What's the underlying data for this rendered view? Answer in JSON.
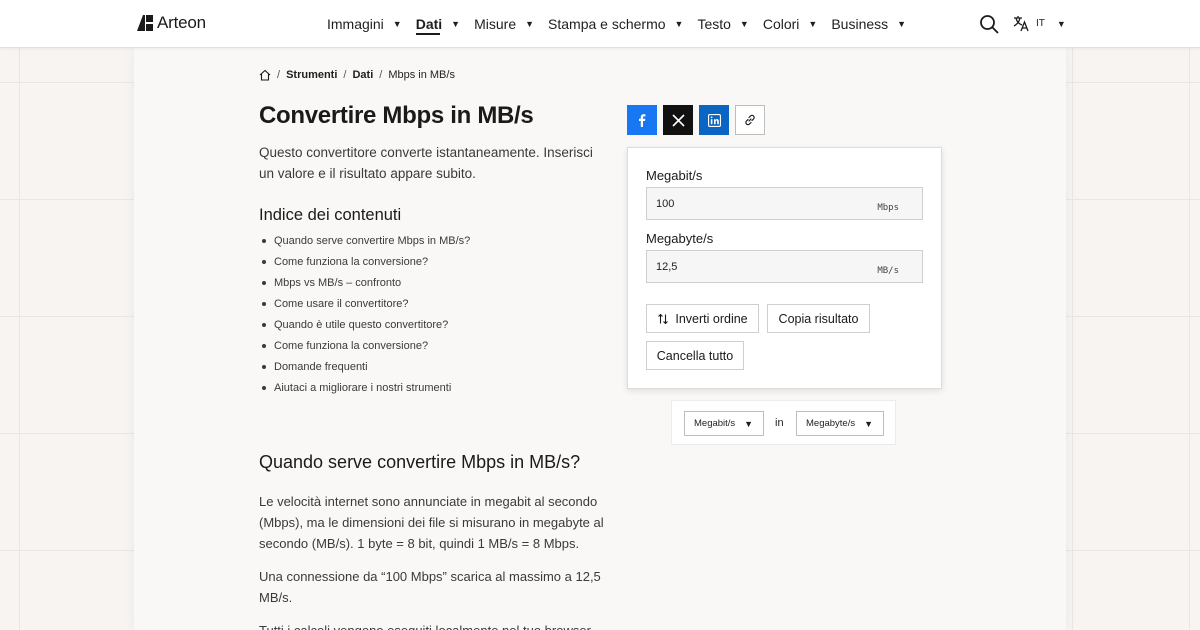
{
  "brand": {
    "name": "Arteon"
  },
  "nav": {
    "items": [
      {
        "label": "Immagini"
      },
      {
        "label": "Dati"
      },
      {
        "label": "Misure"
      },
      {
        "label": "Stampa e schermo"
      },
      {
        "label": "Testo"
      },
      {
        "label": "Colori"
      },
      {
        "label": "Business"
      }
    ],
    "active": "Dati",
    "language": "IT"
  },
  "breadcrumb": {
    "items": [
      "Strumenti",
      "Dati",
      "Mbps in MB/s"
    ],
    "separator": "/"
  },
  "page": {
    "title": "Convertire Mbps in MB/s",
    "intro": "Questo convertitore converte istantaneamente. Inserisci un valore e il risultato appare subito."
  },
  "toc": {
    "title": "Indice dei contenuti",
    "items": [
      "Quando serve convertire Mbps in MB/s?",
      "Come funziona la conversione?",
      "Mbps vs MB/s – confronto",
      "Come usare il convertitore?",
      "Quando è utile questo convertitore?",
      "Come funziona la conversione?",
      "Domande frequenti",
      "Aiutaci a migliorare i nostri strumenti"
    ]
  },
  "section": {
    "title": "Quando serve convertire Mbps in MB/s?",
    "paragraphs": [
      "Le velocità internet sono annunciate in megabit al secondo (Mbps), ma le dimensioni dei file si misurano in megabyte al secondo (MB/s). 1 byte = 8 bit, quindi 1 MB/s = 8 Mbps.",
      "Una connessione da “100 Mbps” scarica al massimo a 12,5 MB/s.",
      "Tutti i calcoli vengono eseguiti localmente nel tuo browser."
    ]
  },
  "share": {
    "icons": [
      "facebook-icon",
      "x-icon",
      "linkedin-icon",
      "link-icon"
    ]
  },
  "converter": {
    "from": {
      "label": "Megabit/s",
      "value": "100",
      "unit": "Mbps"
    },
    "to": {
      "label": "Megabyte/s",
      "value": "12,5",
      "unit": "MB/s"
    },
    "buttons": {
      "swap": "Inverti ordine",
      "copy": "Copia risultato",
      "clear": "Cancella tutto"
    },
    "unit_select": {
      "from": "Megabit/s",
      "connector": "in",
      "to": "Megabyte/s"
    }
  },
  "colors": {
    "facebook": "#1877f2",
    "x": "#111111",
    "linkedin": "#0a66c2",
    "background": "#f7f4f1"
  }
}
